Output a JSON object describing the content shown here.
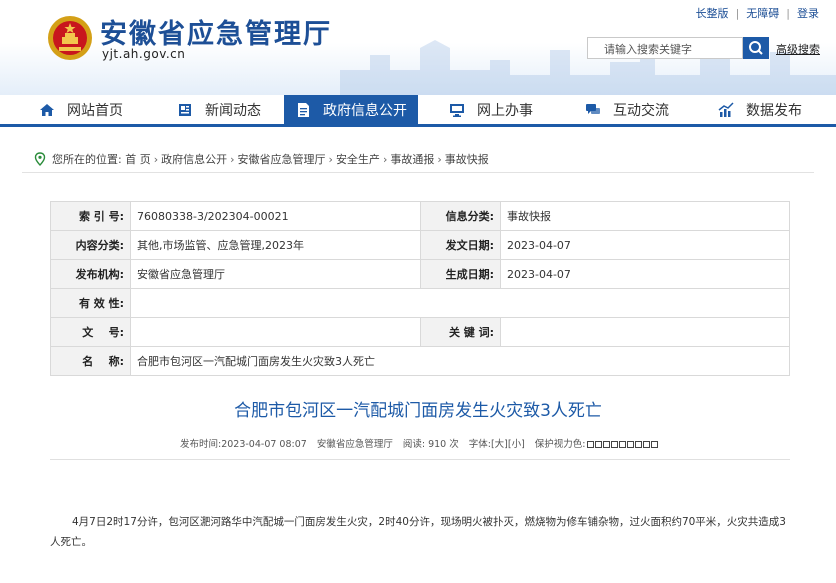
{
  "header": {
    "site_title": "安徽省应急管理厅",
    "site_domain": "yjt.ah.gov.cn",
    "toplinks": [
      "长整版",
      "无障碍",
      "登录"
    ],
    "search_placeholder": "请输入搜索关键字",
    "advanced_search": "高级搜索"
  },
  "nav": {
    "items": [
      {
        "label": "网站首页",
        "icon": "home-icon"
      },
      {
        "label": "新闻动态",
        "icon": "news-icon"
      },
      {
        "label": "政府信息公开",
        "icon": "document-icon",
        "active": true
      },
      {
        "label": "网上办事",
        "icon": "monitor-icon"
      },
      {
        "label": "互动交流",
        "icon": "chat-icon"
      },
      {
        "label": "数据发布",
        "icon": "chart-icon"
      }
    ]
  },
  "breadcrumb": {
    "prefix": "您所在的位置:",
    "items": [
      "首 页",
      "政府信息公开",
      "安徽省应急管理厅",
      "安全生产",
      "事故通报",
      "事故快报"
    ]
  },
  "meta": {
    "index_label": "索 引 号:",
    "index_value": "76080338-3/202304-00021",
    "category_label": "信息分类:",
    "category_value": "事故快报",
    "topic_label": "内容分类:",
    "topic_value": "其他,市场监管、应急管理,2023年",
    "date_label": "发文日期:",
    "date_value": "2023-04-07",
    "org_label": "发布机构:",
    "org_value": "安徽省应急管理厅",
    "effect_date_label": "生成日期:",
    "effect_date_value": "2023-04-07",
    "validity_label": "有 效 性:",
    "validity_value": "",
    "docno_label": "文    号:",
    "docno_value": "",
    "keywords_label": "关 键 词:",
    "keywords_value": "",
    "name_label": "名    称:",
    "name_value": "合肥市包河区一汽配城门面房发生火灾致3人死亡"
  },
  "article": {
    "title": "合肥市包河区一汽配城门面房发生火灾致3人死亡",
    "publish_label": "发布时间:",
    "publish_time": "2023-04-07 08:07",
    "source": "安徽省应急管理厅",
    "views_label": "阅读:",
    "views": "910",
    "views_unit": "次",
    "font_label": "字体:",
    "font_large": "[大]",
    "font_small": "[小]",
    "eye_label": "保护视力色:",
    "body": "4月7日2时17分许，包河区淝河路华中汽配城一门面房发生火灾，2时40分许，现场明火被扑灭，燃烧物为修车铺杂物，过火面积约70平米，火灾共造成3人死亡。"
  },
  "colors": {
    "brand": "#1d5aa7",
    "title_blue": "#1d4f96"
  }
}
